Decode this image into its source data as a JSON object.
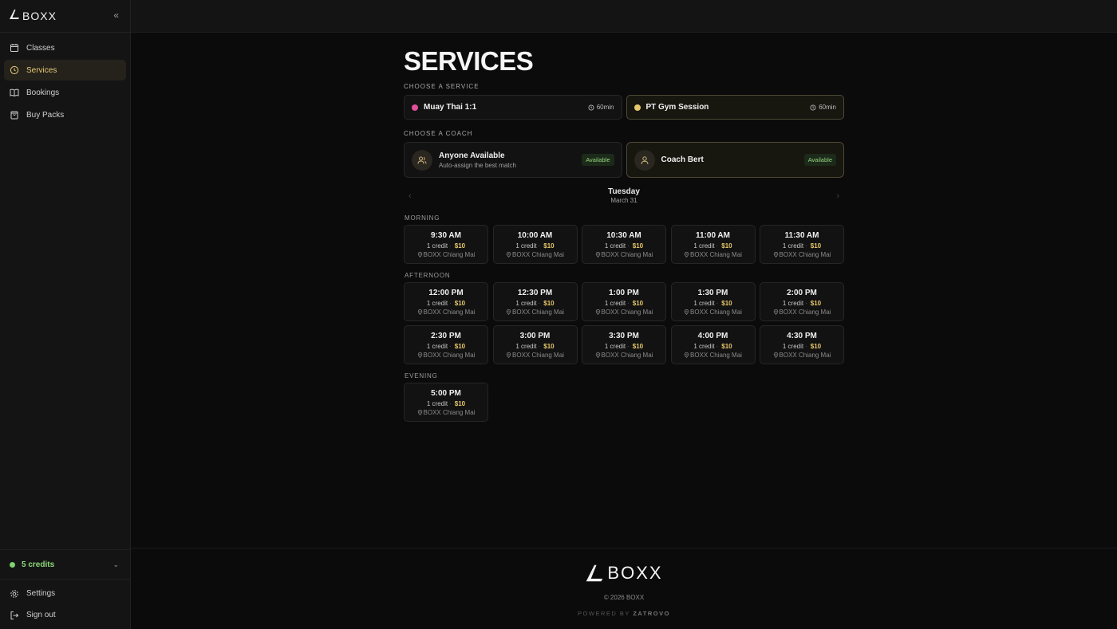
{
  "brand": {
    "name": "BOXX"
  },
  "sidebar": {
    "collapse_icon": "double-chevron-left-icon",
    "items": [
      {
        "label": "Classes",
        "icon": "calendar-icon",
        "active": false
      },
      {
        "label": "Services",
        "icon": "clock-icon",
        "active": true
      },
      {
        "label": "Bookings",
        "icon": "book-icon",
        "active": false
      },
      {
        "label": "Buy Packs",
        "icon": "bag-icon",
        "active": false
      }
    ],
    "credits": "5 credits",
    "bottom": [
      {
        "label": "Settings",
        "icon": "gear-icon"
      },
      {
        "label": "Sign out",
        "icon": "sign-out-icon"
      }
    ]
  },
  "page": {
    "title": "SERVICES"
  },
  "services": {
    "label": "CHOOSE A SERVICE",
    "items": [
      {
        "name": "Muay Thai 1:1",
        "duration": "60min",
        "color": "#e0509a",
        "selected": false
      },
      {
        "name": "PT Gym Session",
        "duration": "60min",
        "color": "#e7c86a",
        "selected": true
      }
    ]
  },
  "coaches": {
    "label": "CHOOSE A COACH",
    "items": [
      {
        "name": "Anyone Available",
        "sub": "Auto-assign the best match",
        "badge": "Available",
        "selected": false
      },
      {
        "name": "Coach Bert",
        "sub": "",
        "badge": "Available",
        "selected": true
      }
    ]
  },
  "day": {
    "name": "Tuesday",
    "date": "March 31"
  },
  "periods": [
    {
      "label": "MORNING",
      "slots": [
        {
          "time": "9:30 AM",
          "credit": "1 credit",
          "price": "$10",
          "location": "BOXX Chiang Mai"
        },
        {
          "time": "10:00 AM",
          "credit": "1 credit",
          "price": "$10",
          "location": "BOXX Chiang Mai"
        },
        {
          "time": "10:30 AM",
          "credit": "1 credit",
          "price": "$10",
          "location": "BOXX Chiang Mai"
        },
        {
          "time": "11:00 AM",
          "credit": "1 credit",
          "price": "$10",
          "location": "BOXX Chiang Mai"
        },
        {
          "time": "11:30 AM",
          "credit": "1 credit",
          "price": "$10",
          "location": "BOXX Chiang Mai"
        }
      ]
    },
    {
      "label": "AFTERNOON",
      "slots": [
        {
          "time": "12:00 PM",
          "credit": "1 credit",
          "price": "$10",
          "location": "BOXX Chiang Mai"
        },
        {
          "time": "12:30 PM",
          "credit": "1 credit",
          "price": "$10",
          "location": "BOXX Chiang Mai"
        },
        {
          "time": "1:00 PM",
          "credit": "1 credit",
          "price": "$10",
          "location": "BOXX Chiang Mai"
        },
        {
          "time": "1:30 PM",
          "credit": "1 credit",
          "price": "$10",
          "location": "BOXX Chiang Mai"
        },
        {
          "time": "2:00 PM",
          "credit": "1 credit",
          "price": "$10",
          "location": "BOXX Chiang Mai"
        },
        {
          "time": "2:30 PM",
          "credit": "1 credit",
          "price": "$10",
          "location": "BOXX Chiang Mai"
        },
        {
          "time": "3:00 PM",
          "credit": "1 credit",
          "price": "$10",
          "location": "BOXX Chiang Mai"
        },
        {
          "time": "3:30 PM",
          "credit": "1 credit",
          "price": "$10",
          "location": "BOXX Chiang Mai"
        },
        {
          "time": "4:00 PM",
          "credit": "1 credit",
          "price": "$10",
          "location": "BOXX Chiang Mai"
        },
        {
          "time": "4:30 PM",
          "credit": "1 credit",
          "price": "$10",
          "location": "BOXX Chiang Mai"
        }
      ]
    },
    {
      "label": "EVENING",
      "slots": [
        {
          "time": "5:00 PM",
          "credit": "1 credit",
          "price": "$10",
          "location": "BOXX Chiang Mai"
        }
      ]
    }
  ],
  "footer": {
    "brand": "BOXX",
    "copyright": "© 2026 BOXX",
    "powered_prefix": "POWERED BY",
    "powered_by": "ZATROVO"
  },
  "colors": {
    "accent": "#e7c86a",
    "credits_green": "#7fd26d",
    "available_green": "#96d47f",
    "background": "#0b0b0c"
  }
}
